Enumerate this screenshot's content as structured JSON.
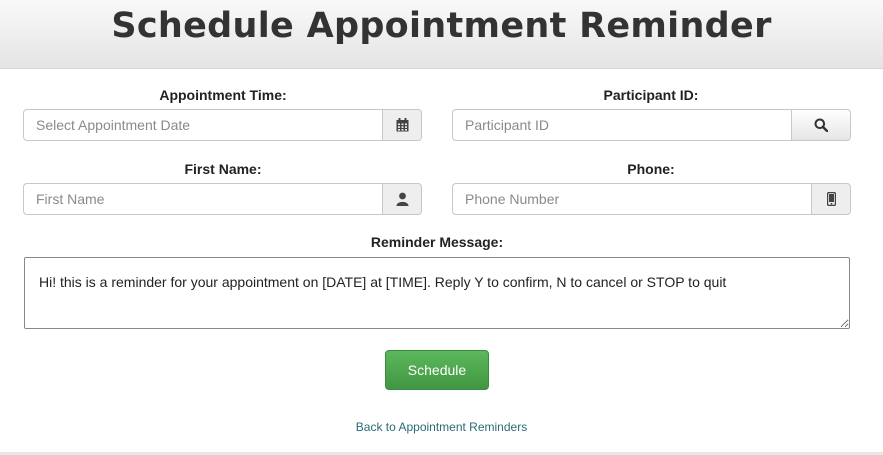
{
  "header": {
    "title": "Schedule Appointment Reminder"
  },
  "form": {
    "appointment_time": {
      "label": "Appointment Time:",
      "placeholder": "Select Appointment Date",
      "icon": "calendar-icon"
    },
    "participant_id": {
      "label": "Participant ID:",
      "placeholder": "Participant ID",
      "icon": "search-icon"
    },
    "first_name": {
      "label": "First Name:",
      "placeholder": "First Name",
      "icon": "user-icon"
    },
    "phone": {
      "label": "Phone:",
      "placeholder": "Phone Number",
      "icon": "mobile-phone-icon"
    },
    "reminder_message": {
      "label": "Reminder Message:",
      "value": "Hi! this is a reminder for your appointment on [DATE] at [TIME]. Reply Y to confirm, N to cancel or STOP to quit"
    },
    "schedule_label": "Schedule"
  },
  "back_link": "Back to Appointment Reminders",
  "colors": {
    "primary_button": "#5cb85c",
    "link": "#2a6a7a",
    "header_bg": "#ececec"
  }
}
